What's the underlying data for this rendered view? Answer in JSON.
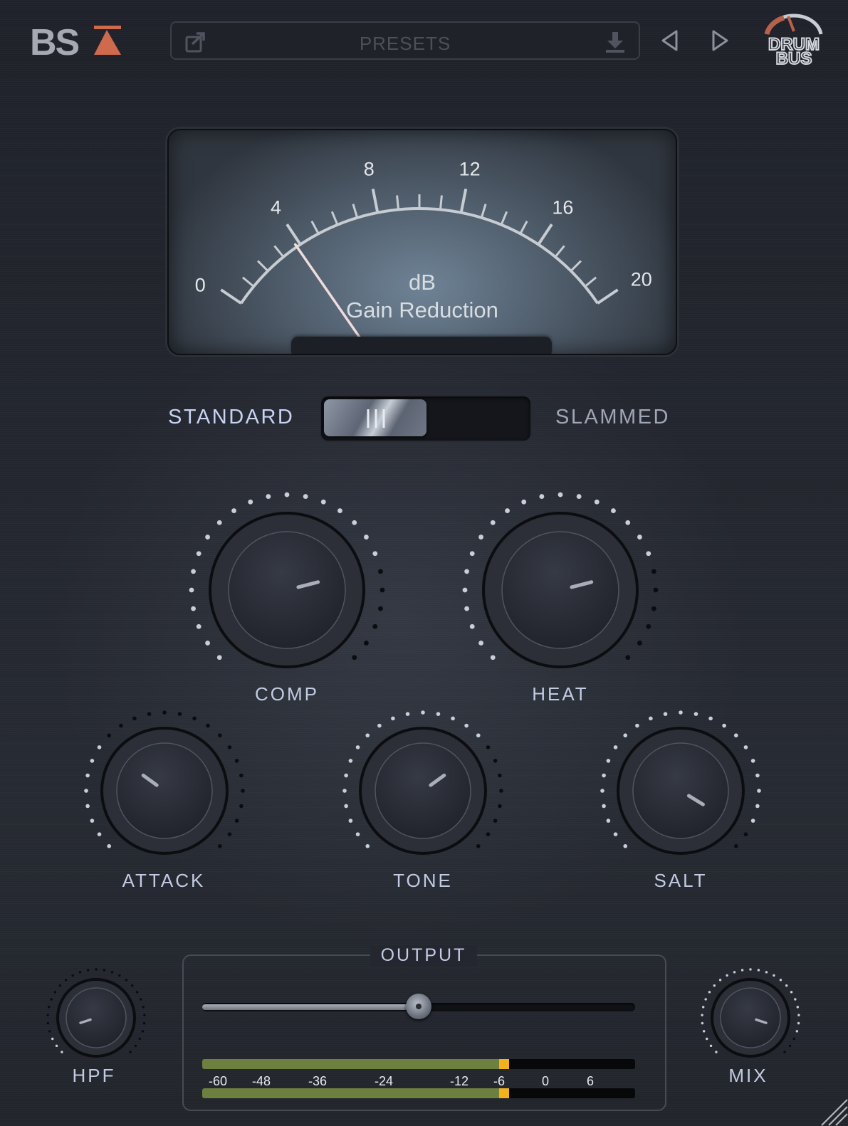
{
  "header": {
    "brand_logo": "BSA",
    "presets": {
      "label": "PRESETS",
      "share_icon": "share-icon",
      "save_icon": "download-icon"
    },
    "prev_icon": "triangle-left-icon",
    "next_icon": "triangle-right-icon",
    "product_logo": {
      "line1": "DRUM",
      "line2": "BUS"
    }
  },
  "meter": {
    "unit": "dB",
    "caption": "Gain Reduction",
    "scale_labels": [
      "0",
      "4",
      "8",
      "12",
      "16",
      "20"
    ],
    "needle_value_db": 3.8
  },
  "mode": {
    "left_label": "STANDARD",
    "right_label": "SLAMMED",
    "selected": "STANDARD"
  },
  "knobs": {
    "comp": {
      "label": "COMP",
      "value": 0.78
    },
    "heat": {
      "label": "HEAT",
      "value": 0.78
    },
    "attack": {
      "label": "ATTACK",
      "value": 0.3
    },
    "tone": {
      "label": "TONE",
      "value": 0.7
    },
    "salt": {
      "label": "SALT",
      "value": 0.95
    },
    "hpf": {
      "label": "HPF",
      "value": 0.1
    },
    "mix": {
      "label": "MIX",
      "value": 0.9
    }
  },
  "output": {
    "title": "OUTPUT",
    "slider_value": 0.5,
    "level_scale": [
      "-60",
      "-48",
      "-36",
      "-24",
      "-12",
      "-6",
      "0",
      "6"
    ],
    "level_left_db": -6,
    "level_right_db": -6,
    "level_color": "#6e8040",
    "peak_color": "#f2b21c"
  }
}
